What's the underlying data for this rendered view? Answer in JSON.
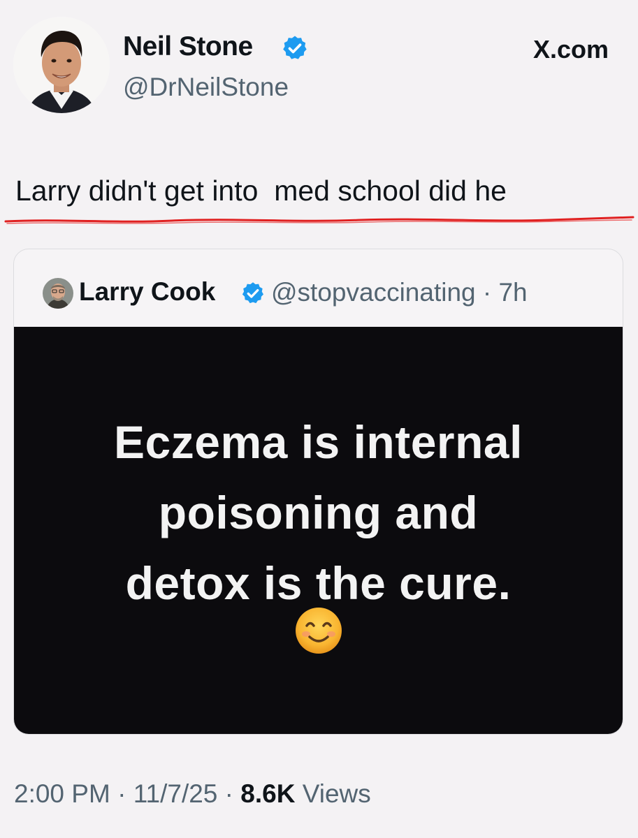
{
  "header": {
    "author_name": "Neil Stone",
    "author_handle": "@DrNeilStone",
    "site_label": "X.com",
    "verified_color": "#1d9bf0"
  },
  "tweet": {
    "text": "Larry didn't get into  med school did he",
    "underline_color": "#e02020"
  },
  "quote": {
    "author_name": "Larry Cook",
    "handle_and_time": "@stopvaccinating · 7h",
    "image_text": [
      "Eczema is internal",
      "poisoning and",
      "detox is the cure."
    ],
    "emoji_icon": "smiling-face-icon"
  },
  "footer": {
    "time": "2:00 PM",
    "separator": " · ",
    "date": "11/7/25",
    "views_count": "8.6K",
    "views_label": "Views"
  }
}
